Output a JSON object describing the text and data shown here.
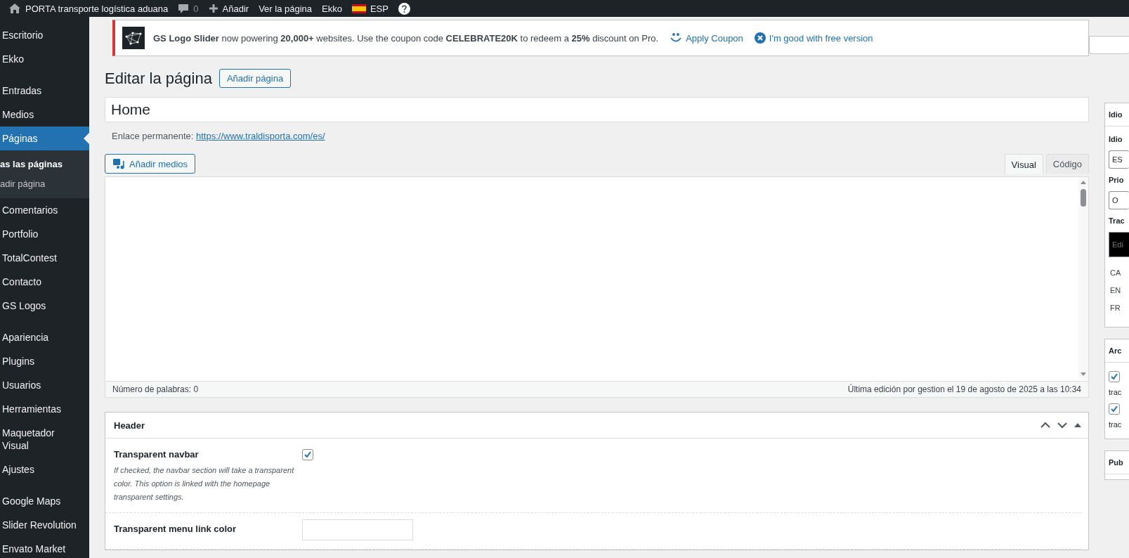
{
  "admin_bar": {
    "site_name": "PORTA transporte logística aduana",
    "comments_count": "0",
    "new_label": "Añadir",
    "view_label": "Ver la página",
    "theme_label": "Ekko",
    "language": "ESP"
  },
  "sidebar": {
    "groups": [
      {
        "items": [
          {
            "label": "Escritorio",
            "selected": false
          },
          {
            "label": "Ekko",
            "selected": false
          }
        ]
      },
      {
        "items": [
          {
            "label": "Entradas",
            "selected": false
          },
          {
            "label": "Medios",
            "selected": false
          },
          {
            "label": "Páginas",
            "selected": true,
            "submenu": [
              {
                "label": "as las páginas",
                "selected": true
              },
              {
                "label": "adir página",
                "selected": false
              }
            ]
          },
          {
            "label": "Comentarios",
            "selected": false
          },
          {
            "label": "Portfolio",
            "selected": false
          },
          {
            "label": "TotalContest",
            "selected": false
          },
          {
            "label": "Contacto",
            "selected": false
          },
          {
            "label": "GS Logos",
            "selected": false
          }
        ]
      },
      {
        "items": [
          {
            "label": "Apariencia",
            "selected": false
          },
          {
            "label": "Plugins",
            "selected": false
          },
          {
            "label": "Usuarios",
            "selected": false
          },
          {
            "label": "Herramientas",
            "selected": false
          },
          {
            "label": "Maquetador Visual",
            "selected": false
          },
          {
            "label": "Ajustes",
            "selected": false
          }
        ]
      },
      {
        "items": [
          {
            "label": "Google Maps",
            "selected": false
          },
          {
            "label": "Slider Revolution",
            "selected": false
          },
          {
            "label": "Envato Market",
            "selected": false
          }
        ]
      }
    ]
  },
  "notice": {
    "text": "**GS Logo Slider** now powering **20,000+** websites. Use the coupon code **CELEBRATE20K** to redeem a **25%** discount on Pro.",
    "apply_link": "Apply Coupon",
    "dismiss_link": "I'm good with free version"
  },
  "page_title": "Editar la página",
  "add_page_button": "Añadir página",
  "title_field": {
    "value": "Home"
  },
  "permalink": {
    "label": "Enlace permanente:",
    "url": "https://www.traldisporta.com/es/"
  },
  "add_media_button": "Añadir medios",
  "editor_tabs": [
    {
      "label": "Visual",
      "selected": true
    },
    {
      "label": "Código",
      "selected": false
    }
  ],
  "status_bar": {
    "word_count": "Número de palabras: 0",
    "last_edit": "Última edición por gestion el 19 de agosto de 2025 a las 10:34"
  },
  "header_box": {
    "title": "Header",
    "fields": [
      {
        "kind": "checkbox",
        "label": "Transparent navbar",
        "checked": true,
        "description": "If checked, the navbar section will take a transparent color. This option is linked with the homepage transparent settings."
      },
      {
        "kind": "color",
        "label": "Transparent menu link color"
      }
    ]
  },
  "right_column": {
    "language_box": {
      "title": "Idio",
      "language_label": "Idio",
      "language_value": "ES",
      "priority_label": "Prio",
      "priority_value": "O",
      "translations_label": "Trac",
      "translations_field_placeholder": "Edi",
      "translations": [
        "CA",
        "EN",
        "FR"
      ]
    },
    "archive_box": {
      "title": "Arc",
      "options": [
        {
          "label": "trac",
          "checked": true
        },
        {
          "label": "trac",
          "checked": true
        }
      ]
    },
    "publish_box": {
      "title": "Pub"
    }
  }
}
